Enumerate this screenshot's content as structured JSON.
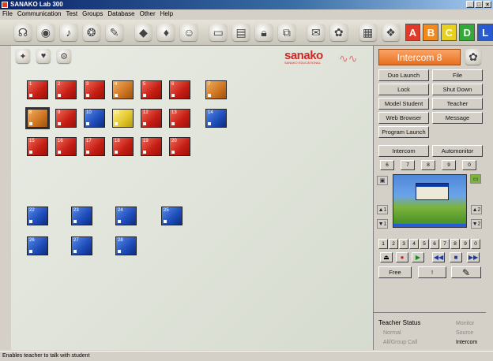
{
  "window": {
    "title": "SANAKO Lab 300"
  },
  "menu": [
    "File",
    "Communication",
    "Test",
    "Groups",
    "Database",
    "Other",
    "Help"
  ],
  "toolbar": {
    "icons": [
      "headset-icon",
      "listen-icon",
      "speaker-icon",
      "broadcast-icon",
      "pen-icon",
      "eraser-icon",
      "microphone-icon",
      "students-icon",
      "monitor-icon",
      "presentation-icon",
      "lock-icon",
      "network-icon",
      "chat-icon",
      "paint-icon",
      "grid-icon",
      "group-icon"
    ],
    "group_letters": [
      {
        "label": "A",
        "color": "#e03a2a"
      },
      {
        "label": "B",
        "color": "#f08a20"
      },
      {
        "label": "C",
        "color": "#e8d020"
      },
      {
        "label": "D",
        "color": "#35a83a"
      },
      {
        "label": "L",
        "color": "#2a5ad0"
      }
    ]
  },
  "brand": {
    "logo_text": "sanako",
    "logo_sub": "SANAKO EDUCATIONAL"
  },
  "students": [
    {
      "id": "1",
      "color": "red"
    },
    {
      "id": "2",
      "color": "red"
    },
    {
      "id": "3",
      "color": "red"
    },
    {
      "id": "4",
      "color": "orange"
    },
    {
      "id": "5",
      "color": "red"
    },
    {
      "id": "6",
      "color": "red"
    },
    {
      "id": "7",
      "color": "orange"
    },
    {
      "id": "8",
      "color": "orange",
      "selected": true
    },
    {
      "id": "9",
      "color": "red"
    },
    {
      "id": "10",
      "color": "blue"
    },
    {
      "id": "11",
      "color": "yellow"
    },
    {
      "id": "12",
      "color": "red"
    },
    {
      "id": "13",
      "color": "red"
    },
    {
      "id": "14",
      "color": "blue"
    },
    {
      "id": "15",
      "color": "red"
    },
    {
      "id": "16",
      "color": "red"
    },
    {
      "id": "17",
      "color": "red"
    },
    {
      "id": "18",
      "color": "red"
    },
    {
      "id": "19",
      "color": "red"
    },
    {
      "id": "20",
      "color": "red"
    },
    {
      "id": "22",
      "color": "blue"
    },
    {
      "id": "23",
      "color": "blue"
    },
    {
      "id": "24",
      "color": "blue"
    },
    {
      "id": "25",
      "color": "blue"
    },
    {
      "id": "26",
      "color": "blue"
    },
    {
      "id": "27",
      "color": "blue"
    },
    {
      "id": "28",
      "color": "blue"
    }
  ],
  "panel": {
    "mode_title": "Intercom 8",
    "buttons": {
      "duo_launch": "Duo Launch",
      "file": "File",
      "lock": "Lock",
      "shut_down": "Shut Down",
      "model_student": "Model Student",
      "teacher": "Teacher",
      "web_browser": "Web Browser",
      "message": "Message",
      "program_launch": "Program Launch"
    },
    "tabs": {
      "intercom": "Intercom",
      "automonitor": "Automonitor"
    },
    "channel_numbers": [
      "6",
      "7",
      "8",
      "9",
      "0"
    ],
    "side_left": [
      "▲1",
      "▼1"
    ],
    "side_right": [
      "▲2",
      "▼2"
    ],
    "digit_row": [
      "1",
      "2",
      "3",
      "4",
      "5",
      "6",
      "7",
      "8",
      "9",
      "0"
    ],
    "free": "Free",
    "exclaim": "!",
    "teacher_status": {
      "label": "Teacher Status",
      "monitor": "Monitor",
      "normal": "Normal",
      "source": "Source",
      "all_group_call": "All/Group Call",
      "intercom": "Intercom"
    }
  },
  "status": "Enables teacher to talk with student"
}
